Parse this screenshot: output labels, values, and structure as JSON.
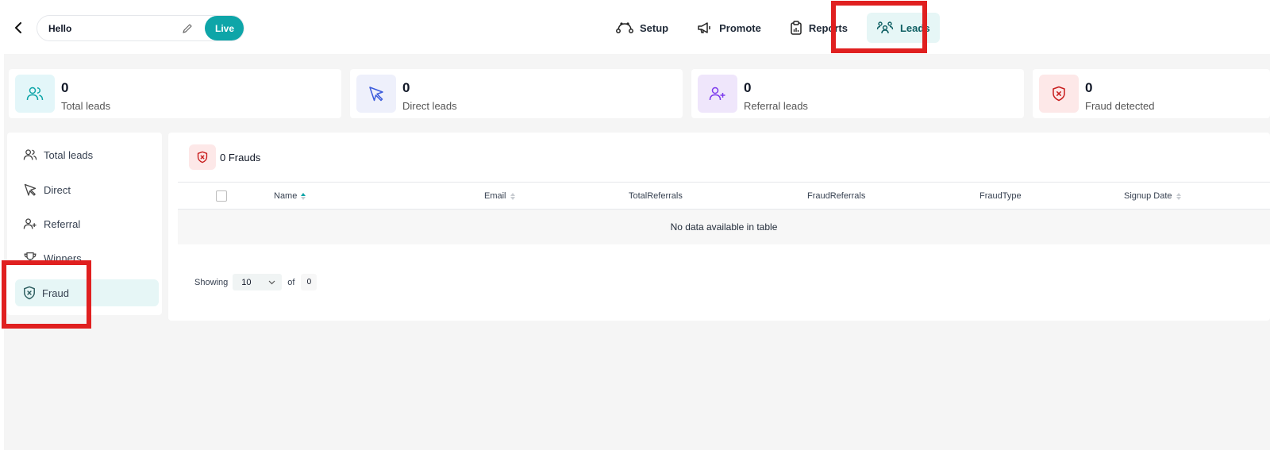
{
  "header": {
    "campaign_name": "Hello",
    "live_label": "Live",
    "nav": [
      {
        "label": "Setup",
        "icon": "route-icon"
      },
      {
        "label": "Promote",
        "icon": "megaphone-icon"
      },
      {
        "label": "Reports",
        "icon": "clipboard-chart-icon"
      },
      {
        "label": "Leads",
        "icon": "users-group-icon",
        "active": true
      }
    ]
  },
  "stats": [
    {
      "value": "0",
      "label": "Total leads",
      "icon": "users-icon",
      "bg": "#e3f6f9",
      "color": "#0ea5a8"
    },
    {
      "value": "0",
      "label": "Direct leads",
      "icon": "cursor-arrow-icon",
      "bg": "#eef0fb",
      "color": "#3b5bdb"
    },
    {
      "value": "0",
      "label": "Referral leads",
      "icon": "user-plus-icon",
      "bg": "#efe6fb",
      "color": "#7c3aed"
    },
    {
      "value": "0",
      "label": "Fraud detected",
      "icon": "shield-x-icon",
      "bg": "#fde8e8",
      "color": "#c81e1e"
    }
  ],
  "sidebar": {
    "items": [
      {
        "label": "Total leads",
        "icon": "users-icon"
      },
      {
        "label": "Direct",
        "icon": "cursor-arrow-icon"
      },
      {
        "label": "Referral",
        "icon": "user-plus-icon"
      },
      {
        "label": "Winners",
        "icon": "trophy-icon"
      },
      {
        "label": "Fraud",
        "icon": "shield-x-icon",
        "active": true
      }
    ]
  },
  "main": {
    "fraud_count": "0 Frauds",
    "columns": {
      "name": "Name",
      "email": "Email",
      "total_referrals": "TotalReferrals",
      "fraud_referrals": "FraudReferrals",
      "fraud_type": "FraudType",
      "signup_date": "Signup Date"
    },
    "empty_message": "No data available in table",
    "pager": {
      "showing_label": "Showing",
      "page_size": "10",
      "of_label": "of",
      "total": "0"
    }
  },
  "colors": {
    "accent": "#0ea5a8",
    "highlight": "#e02020"
  }
}
